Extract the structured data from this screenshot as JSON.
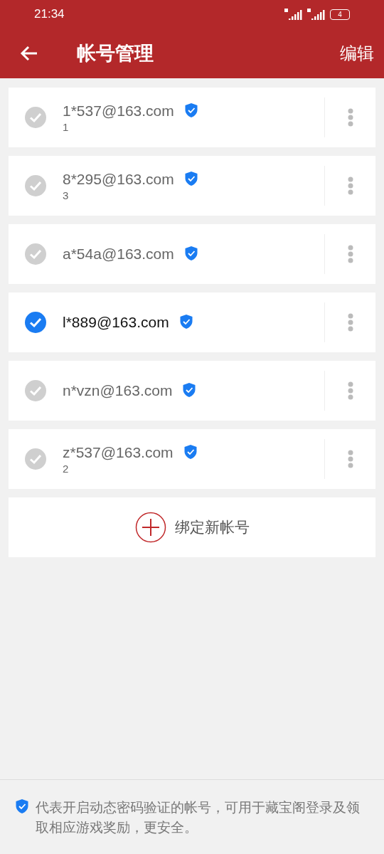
{
  "status_bar": {
    "time": "21:34",
    "battery": "4"
  },
  "toolbar": {
    "title": "帐号管理",
    "action": "编辑"
  },
  "accounts": [
    {
      "email": "1*537@163.com",
      "note": "1",
      "selected": false,
      "verified": true
    },
    {
      "email": "8*295@163.com",
      "note": "3",
      "selected": false,
      "verified": true
    },
    {
      "email": "a*54a@163.com",
      "selected": false,
      "verified": true
    },
    {
      "email": "l*889@163.com",
      "selected": true,
      "verified": true
    },
    {
      "email": "n*vzn@163.com",
      "selected": false,
      "verified": true
    },
    {
      "email": "z*537@163.com",
      "note": "2",
      "selected": false,
      "verified": true
    }
  ],
  "add_button": {
    "label": "绑定新帐号"
  },
  "footer": {
    "text": "代表开启动态密码验证的帐号，可用于藏宝阁登录及领取相应游戏奖励，更安全。"
  }
}
